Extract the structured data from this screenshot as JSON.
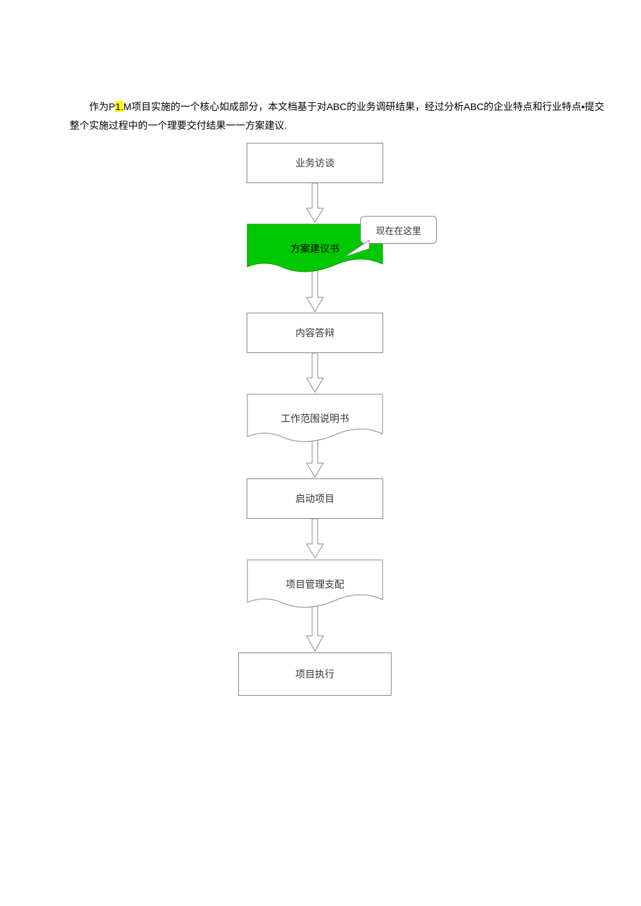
{
  "paragraph": {
    "prefix": "作为P",
    "highlighted": "1.",
    "suffix": "M项目实施的一个核心如成部分，本文档基于对ABC的业务调研结果，经过分析ABC的企业特点和行业特点•提交整个实施过程中的一个理要交付结果一一方案建议."
  },
  "callout": "现在在这里",
  "flow": {
    "nodes": [
      {
        "id": "n1",
        "type": "rect",
        "label": "业务访谈"
      },
      {
        "id": "n2",
        "type": "doc",
        "label": "方案建议书",
        "highlighted": true
      },
      {
        "id": "n3",
        "type": "rect",
        "label": "内容答辩"
      },
      {
        "id": "n4",
        "type": "doc",
        "label": "工作范围说明书"
      },
      {
        "id": "n5",
        "type": "rect",
        "label": "启动项目"
      },
      {
        "id": "n6",
        "type": "doc",
        "label": "项目管理支配"
      },
      {
        "id": "n7",
        "type": "rect",
        "label": "项目执行"
      }
    ]
  },
  "chart_data": {
    "type": "flowchart",
    "direction": "top-to-bottom",
    "nodes": [
      {
        "id": "n1",
        "shape": "rectangle",
        "label": "业务访谈"
      },
      {
        "id": "n2",
        "shape": "document",
        "label": "方案建议书",
        "highlighted": true,
        "annotation": "现在在这里"
      },
      {
        "id": "n3",
        "shape": "rectangle",
        "label": "内容答辩"
      },
      {
        "id": "n4",
        "shape": "document",
        "label": "工作范围说明书"
      },
      {
        "id": "n5",
        "shape": "rectangle",
        "label": "启动项目"
      },
      {
        "id": "n6",
        "shape": "document",
        "label": "项目管理支配"
      },
      {
        "id": "n7",
        "shape": "rectangle",
        "label": "项目执行"
      }
    ],
    "edges": [
      {
        "from": "n1",
        "to": "n2"
      },
      {
        "from": "n2",
        "to": "n3"
      },
      {
        "from": "n3",
        "to": "n4"
      },
      {
        "from": "n4",
        "to": "n5"
      },
      {
        "from": "n5",
        "to": "n6"
      },
      {
        "from": "n6",
        "to": "n7"
      }
    ],
    "colors": {
      "highlight_fill": "#00c800",
      "default_stroke": "#888888"
    }
  }
}
